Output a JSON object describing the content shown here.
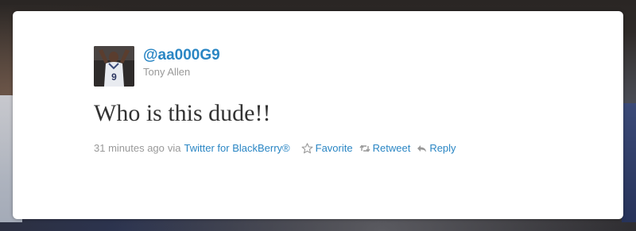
{
  "tweet": {
    "screen_name": "@aa000G9",
    "full_name": "Tony Allen",
    "text": "Who is this dude!!",
    "timestamp": "31 minutes ago",
    "via_label": "via",
    "source": "Twitter for BlackBerry®",
    "avatar_jersey_number": "9"
  },
  "actions": {
    "favorite_label": "Favorite",
    "retweet_label": "Retweet",
    "reply_label": "Reply"
  },
  "colors": {
    "link": "#2a86c4",
    "muted": "#999999",
    "text": "#333333",
    "card": "#ffffff"
  },
  "icons": {
    "favorite": "star-outline-icon",
    "retweet": "retweet-arrows-icon",
    "reply": "reply-arrow-icon"
  }
}
